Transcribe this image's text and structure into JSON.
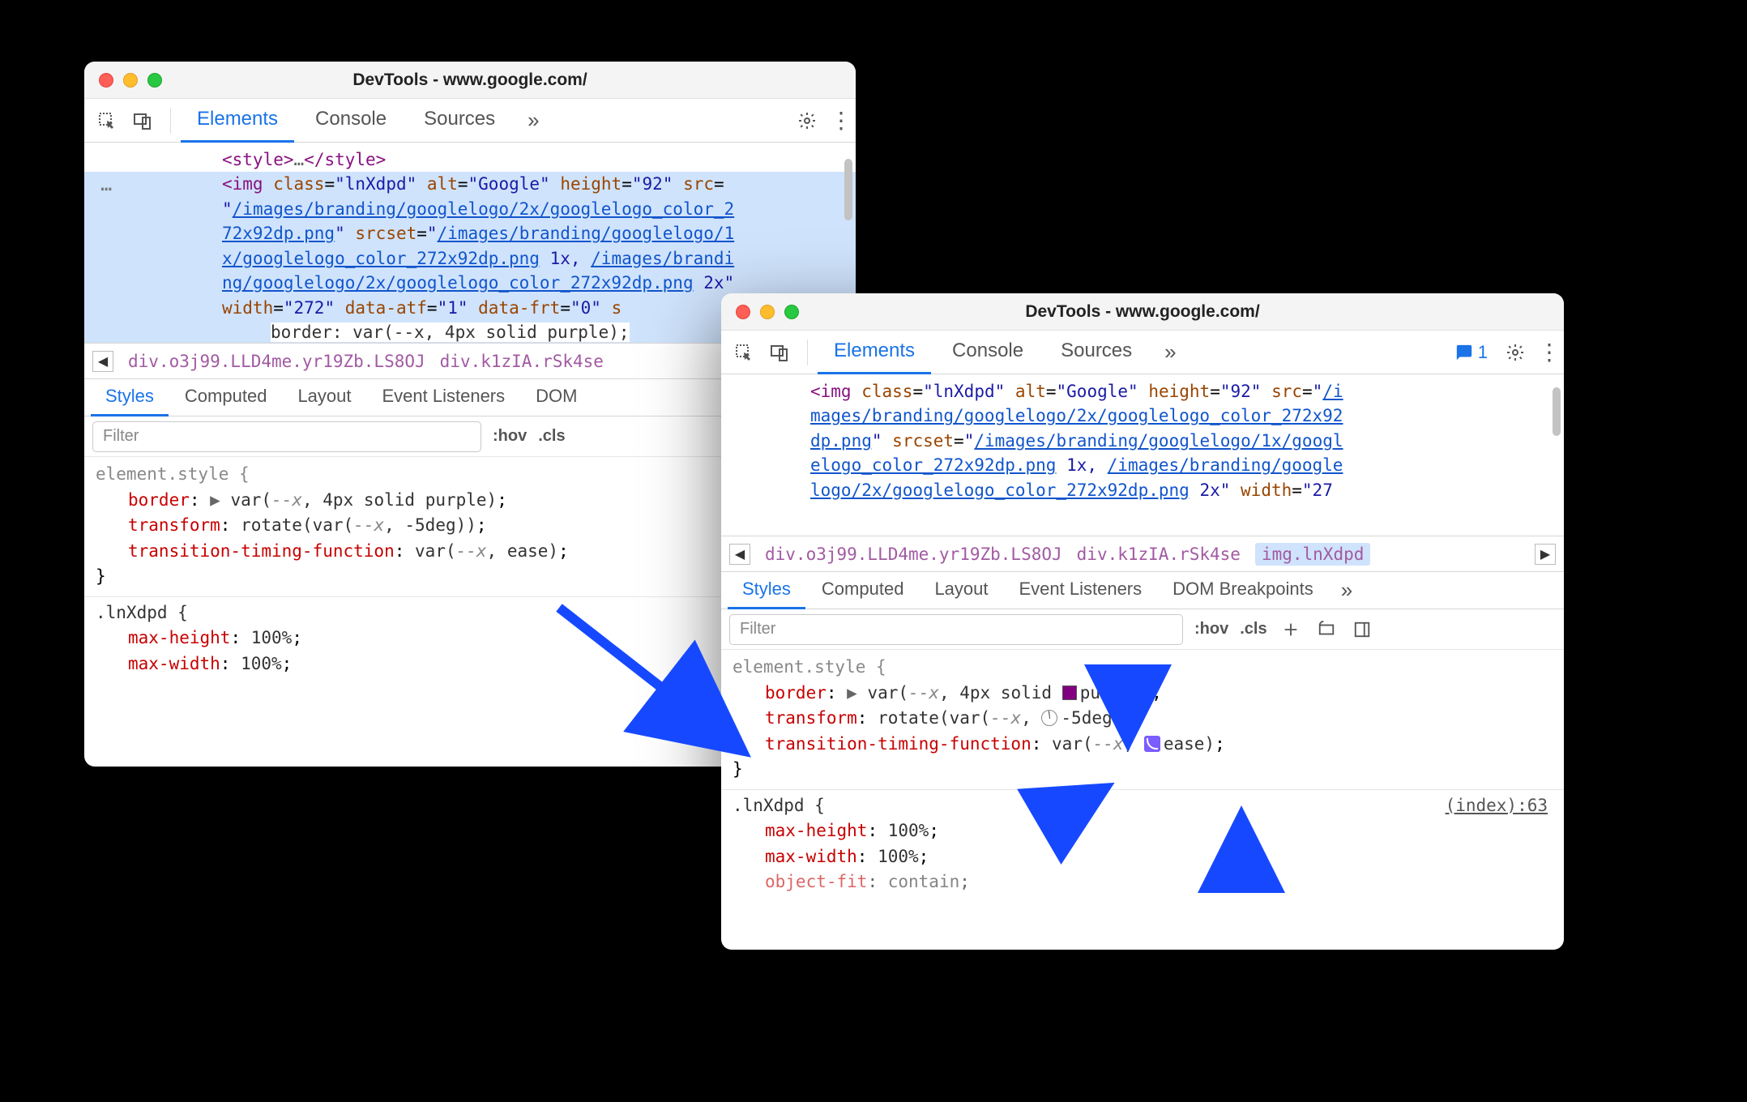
{
  "windows": {
    "left": {
      "title": "DevTools - www.google.com/",
      "tabs": {
        "elements": "Elements",
        "console": "Console",
        "sources": "Sources"
      },
      "dom": {
        "style_close": "<style>…</style>",
        "img_open": "<img",
        "class_attr": "class=",
        "class_val": "\"lnXdpd\"",
        "alt_attr": "alt=",
        "alt_val": "\"Google\"",
        "height_attr": "height=",
        "height_val": "\"92\"",
        "src_attr": "src=",
        "src_val": "\"/images/branding/googlelogo/2x/googlelogo_color_272x92dp.png\"",
        "srcset_attr": "srcset=",
        "srcset_val1": "\"/images/branding/googlelogo/1x/googlelogo_color_272x92dp.png",
        "srcset_1x": " 1x, ",
        "srcset_val2": "/images/branding/googlelogo/2x/googlelogo_color_272x92dp.png",
        "srcset_2x_close": " 2x\"",
        "width_attr": "width=",
        "width_val": "\"272\"",
        "data_atf_attr": "data-atf=",
        "data_atf_val": "\"1\"",
        "data_frt_attr": "data-frt=",
        "data_frt_val": "\"0\"",
        "style_inline_open": "s",
        "style_inline": "border: var(--x, 4px solid purple);"
      },
      "breadcrumb": {
        "a": "div.o3j99.LLD4me.yr19Zb.LS8OJ",
        "b": "div.k1zIA.rSk4se"
      },
      "subtabs": {
        "styles": "Styles",
        "computed": "Computed",
        "layout": "Layout",
        "listeners": "Event Listeners",
        "dom_more": "DOM "
      },
      "filter_placeholder": "Filter",
      "hov": ":hov",
      "cls": ".cls",
      "element_style": "element.style {",
      "rule_border_name": "border",
      "rule_border_val": "var(--x, 4px solid purple)",
      "rule_transform_name": "transform",
      "rule_transform_val": "rotate(var(--x, -5deg))",
      "rule_ttf_name": "transition-timing-function",
      "rule_ttf_val": "var(--x, ease)",
      "close_brace": "}",
      "lnxdpd_selector": ".lnXdpd {",
      "maxh_name": "max-height",
      "maxh_val": "100%",
      "maxw_name": "max-width",
      "maxw_val": "100%"
    },
    "right": {
      "title": "DevTools - www.google.com/",
      "tabs": {
        "elements": "Elements",
        "console": "Console",
        "sources": "Sources"
      },
      "issues_count": "1",
      "dom": {
        "img_open": "<img",
        "class_attr": "class=",
        "class_val": "\"lnXdpd\"",
        "alt_attr": "alt=",
        "alt_val": "\"Google\"",
        "height_attr": "height=",
        "height_val": "\"92\"",
        "src_attr": "src=",
        "src_val": "\"/images/branding/googlelogo/2x/googlelogo_color_272x92dp.png\"",
        "srcset_attr": "srcset=",
        "srcset_val1": "\"/images/branding/googlelogo/1x/googlelogo_color_272x92dp.png",
        "srcset_1x": " 1x, ",
        "srcset_val2": "/images/branding/googlelogo/2x/googlelogo_color_272x92dp.png",
        "srcset_2x_close": " 2x\"",
        "width_attr": "width=",
        "width_val": "\"27"
      },
      "breadcrumb": {
        "a": "div.o3j99.LLD4me.yr19Zb.LS8OJ",
        "b": "div.k1zIA.rSk4se",
        "c": "img.lnXdpd"
      },
      "subtabs": {
        "styles": "Styles",
        "computed": "Computed",
        "layout": "Layout",
        "listeners": "Event Listeners",
        "dombp": "DOM Breakpoints"
      },
      "filter_placeholder": "Filter",
      "hov": ":hov",
      "cls": ".cls",
      "element_style": "element.style {",
      "rule_border_name": "border",
      "rule_border_pre": "var(--x, 4px solid ",
      "rule_border_color": "purple",
      "rule_transform_name": "transform",
      "rule_transform_pre": "rotate(var(--x, ",
      "rule_transform_deg": "-5deg",
      "rule_ttf_name": "transition-timing-function",
      "rule_ttf_pre": "var(--x, ",
      "rule_ttf_ease": "ease",
      "close_brace": "}",
      "lnxdpd_selector": ".lnXdpd {",
      "source_link": "(index):63",
      "maxh_name": "max-height",
      "maxh_val": "100%",
      "maxw_name": "max-width",
      "maxw_val": "100%",
      "objfit_name": "object-fit",
      "objfit_val": "contain"
    }
  }
}
